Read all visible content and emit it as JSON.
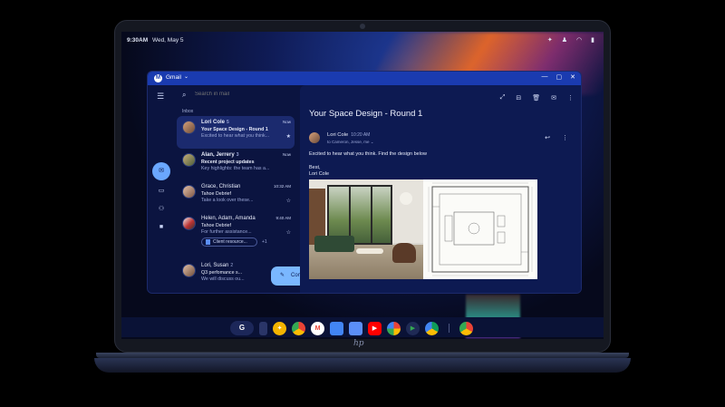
{
  "status_bar": {
    "time": "9:30AM",
    "date": "Wed, May 5",
    "icons": [
      "sparkle-icon",
      "notification-icon",
      "wifi-icon",
      "battery-icon"
    ]
  },
  "window": {
    "app_name": "Gmail",
    "logo_letter": "M"
  },
  "list": {
    "search_placeholder": "Search in mail",
    "section_label": "Inbox",
    "mails": [
      {
        "sender": "Lori Cole",
        "count": "5",
        "time": "Now",
        "subject": "Your Space Design - Round 1",
        "preview": "Excited to hear what you think...",
        "unread": true,
        "selected": true
      },
      {
        "sender": "Alan, Jerrery",
        "count": "3",
        "time": "Now",
        "subject": "Recent project updates",
        "preview": "Key highlights: the team has a...",
        "unread": true,
        "selected": false
      },
      {
        "sender": "Grace, Christian",
        "count": "",
        "time": "10:32 AM",
        "subject": "Tahoe Debrief",
        "preview": "Take a look over these...",
        "unread": false,
        "selected": false
      },
      {
        "sender": "Helen, Adam, Amanda",
        "count": "",
        "time": "9:40 AM",
        "subject": "Tahoe Debrief",
        "preview": "For further assistance...",
        "unread": false,
        "selected": false,
        "attachment": "Client resource...",
        "attachment_more": "+1"
      },
      {
        "sender": "Lori, Susan",
        "count": "2",
        "time": "",
        "subject": "Q3 perfomance s...",
        "preview": "We will discuss ou...",
        "unread": false,
        "selected": false
      }
    ],
    "compose_label": "Compose"
  },
  "reader": {
    "subject": "Your Space Design - Round 1",
    "sender": "Lori Cole",
    "time": "10:20 AM",
    "to": "to Cameron, Jesse, me",
    "body_line1": "Excited to hear what you think. Find the design below",
    "body_line2": "Best,",
    "body_line3": "Lori Cole"
  },
  "dock": {
    "launcher": "G",
    "apps": [
      {
        "name": "assistant-app-icon",
        "color": "#f4b400"
      },
      {
        "name": "chrome-app-icon",
        "color": "#ea4335"
      },
      {
        "name": "gmail-app-icon",
        "color": "#ffffff"
      },
      {
        "name": "calendar-app-icon",
        "color": "#4285f4"
      },
      {
        "name": "files-app-icon",
        "color": "#5b8ef7"
      },
      {
        "name": "youtube-app-icon",
        "color": "#ff0000"
      },
      {
        "name": "photos-app-icon",
        "color": "#fbbc05"
      },
      {
        "name": "play-store-app-icon",
        "color": "#34a853"
      },
      {
        "name": "drive-app-icon",
        "color": "#0f9d58"
      },
      {
        "name": "chrome-secondary-app-icon",
        "color": "#4285f4"
      }
    ]
  },
  "device": {
    "brand": "hp"
  }
}
